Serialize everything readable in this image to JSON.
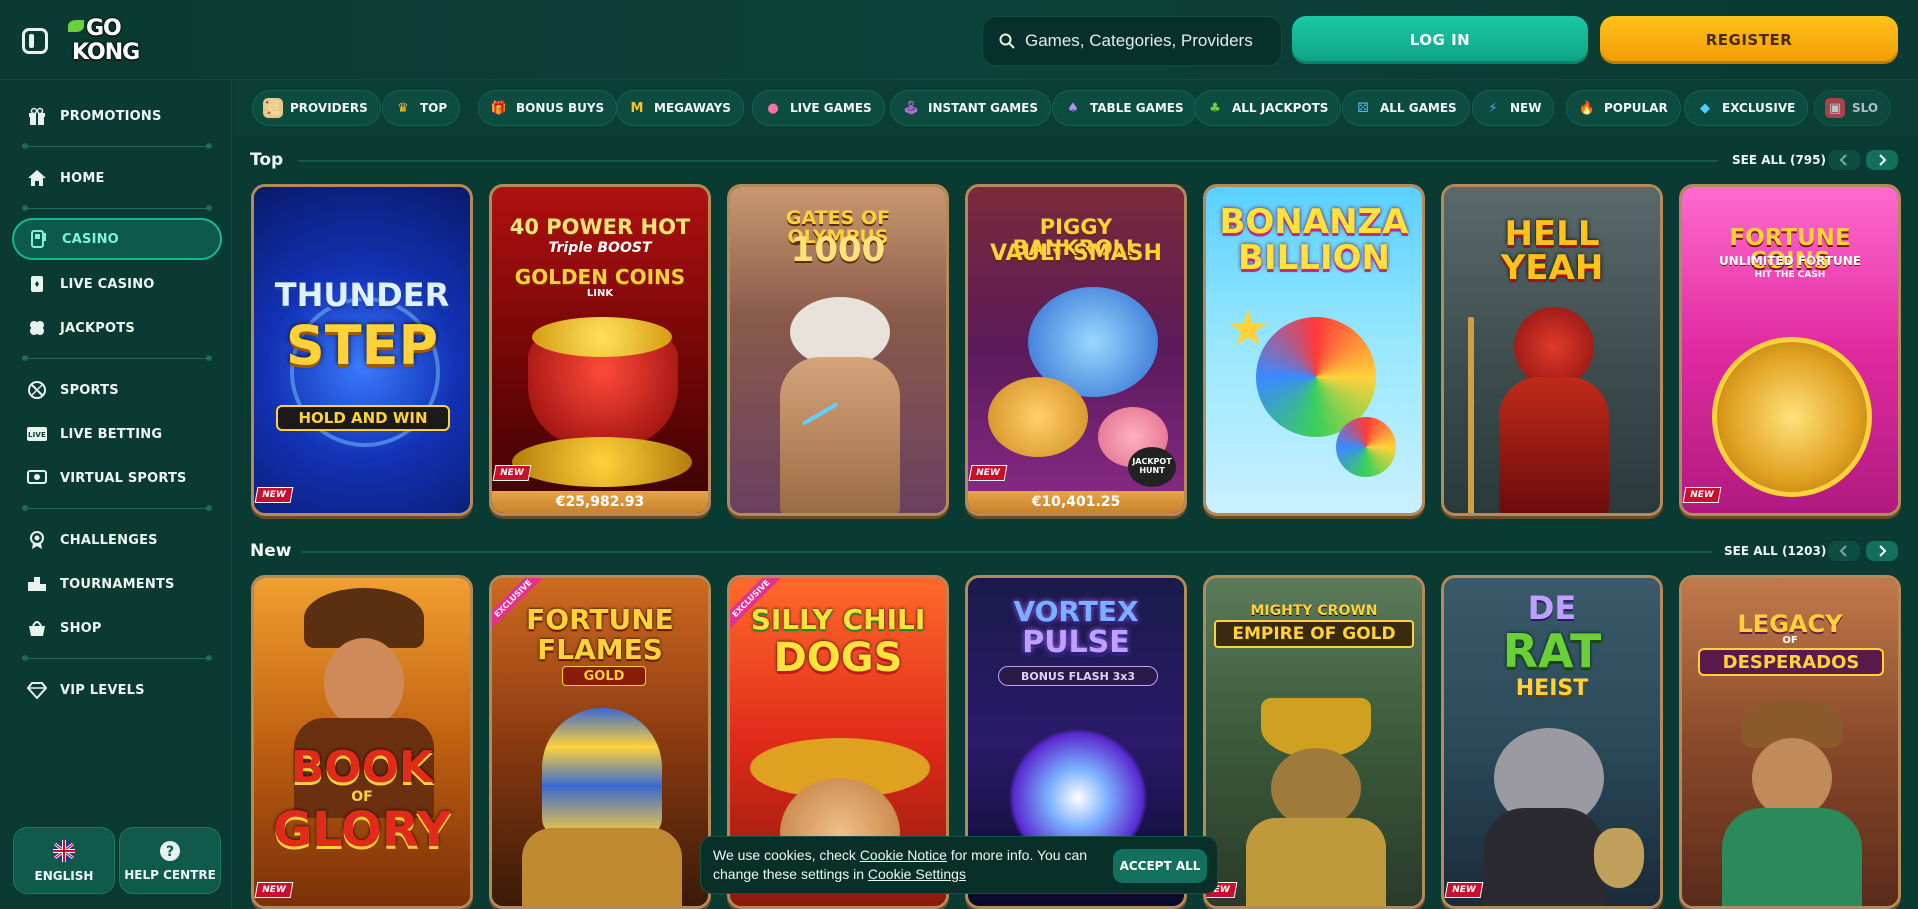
{
  "header": {
    "logo_line1": "GO",
    "logo_line2": "KONG",
    "search_placeholder": "Games, Categories, Providers",
    "login_label": "LOG IN",
    "register_label": "REGISTER"
  },
  "sidebar": {
    "items": [
      {
        "label": "PROMOTIONS",
        "icon": "gift-icon"
      },
      {
        "label": "HOME",
        "icon": "home-icon"
      },
      {
        "label": "CASINO",
        "icon": "slot-machine-icon",
        "active": true
      },
      {
        "label": "LIVE CASINO",
        "icon": "cards-icon"
      },
      {
        "label": "JACKPOTS",
        "icon": "clover-icon"
      },
      {
        "label": "SPORTS",
        "icon": "ball-icon"
      },
      {
        "label": "LIVE BETTING",
        "icon": "live-icon"
      },
      {
        "label": "VIRTUAL SPORTS",
        "icon": "virtual-sports-icon"
      },
      {
        "label": "CHALLENGES",
        "icon": "medal-icon"
      },
      {
        "label": "TOURNAMENTS",
        "icon": "podium-icon"
      },
      {
        "label": "SHOP",
        "icon": "basket-icon"
      },
      {
        "label": "VIP LEVELS",
        "icon": "diamond-icon"
      }
    ],
    "language_label": "ENGLISH",
    "help_label": "HELP CENTRE"
  },
  "categories": [
    {
      "label": "PROVIDERS",
      "icon": "scroll-icon"
    },
    {
      "label": "TOP",
      "icon": "crown-icon"
    },
    {
      "label": "BONUS BUYS",
      "icon": "gift-box-icon"
    },
    {
      "label": "MEGAWAYS",
      "icon": "m-icon"
    },
    {
      "label": "LIVE GAMES",
      "icon": "chip-icon"
    },
    {
      "label": "INSTANT GAMES",
      "icon": "joystick-icon"
    },
    {
      "label": "TABLE GAMES",
      "icon": "spade-icon"
    },
    {
      "label": "ALL JACKPOTS",
      "icon": "clover-icon"
    },
    {
      "label": "ALL GAMES",
      "icon": "dice-icon"
    },
    {
      "label": "NEW",
      "icon": "lightning-icon"
    },
    {
      "label": "POPULAR",
      "icon": "flame-icon"
    },
    {
      "label": "EXCLUSIVE",
      "icon": "gem-icon"
    },
    {
      "label": "SLO",
      "icon": "slot-icon"
    }
  ],
  "sections": {
    "top": {
      "title": "Top",
      "see_all": "SEE ALL (795)"
    },
    "new": {
      "title": "New",
      "see_all": "SEE ALL (1203)"
    }
  },
  "top_games": [
    {
      "line1": "THUNDER",
      "line2": "STEP",
      "sub": "HOLD AND WIN",
      "badge": "NEW"
    },
    {
      "line1": "40 POWER HOT",
      "line2": "GOLDEN COINS",
      "sub": "Triple BOOST",
      "extra": "LINK",
      "jackpot": "€25,982.93",
      "badge": "NEW"
    },
    {
      "line1": "GATES OF OLYMPUS",
      "line2": "1000"
    },
    {
      "line1": "PIGGY BANKROLL",
      "line2": "VAULT SMASH",
      "extra": "JACKPOT HUNT",
      "jackpot": "€10,401.25",
      "badge": "NEW"
    },
    {
      "line1": "BONANZA",
      "line2": "BILLION"
    },
    {
      "line1": "HELL YEAH",
      "line2": ""
    },
    {
      "line1": "FORTUNE COINS",
      "line2": "UNLIMITED FORTUNE",
      "sub": "HIT THE CASH",
      "badge": "NEW"
    }
  ],
  "new_games": [
    {
      "line1": "BOOK",
      "line2": "GLORY",
      "sub": "OF",
      "badge": "NEW"
    },
    {
      "line1": "FORTUNE",
      "line2": "FLAMES",
      "sub": "GOLD",
      "exclusive": "EXCLUSIVE"
    },
    {
      "line1": "SILLY CHILI",
      "line2": "DOGS",
      "exclusive": "EXCLUSIVE"
    },
    {
      "line1": "VORTEX",
      "line2": "PULSE",
      "sub": "BONUS FLASH 3x3"
    },
    {
      "line1": "MIGHTY CROWN",
      "line2": "EMPIRE OF GOLD",
      "badge": "NEW"
    },
    {
      "line1": "DE",
      "line2": "RAT",
      "sub": "HEIST",
      "badge": "NEW"
    },
    {
      "line1": "LEGACY",
      "line2": "DESPERADOS",
      "sub": "OF"
    }
  ],
  "cookie": {
    "text_before": "We use cookies, check ",
    "link1": "Cookie Notice",
    "text_mid": " for more info. You can change these settings in ",
    "link2": "Cookie Settings",
    "accept_label": "ACCEPT ALL"
  }
}
